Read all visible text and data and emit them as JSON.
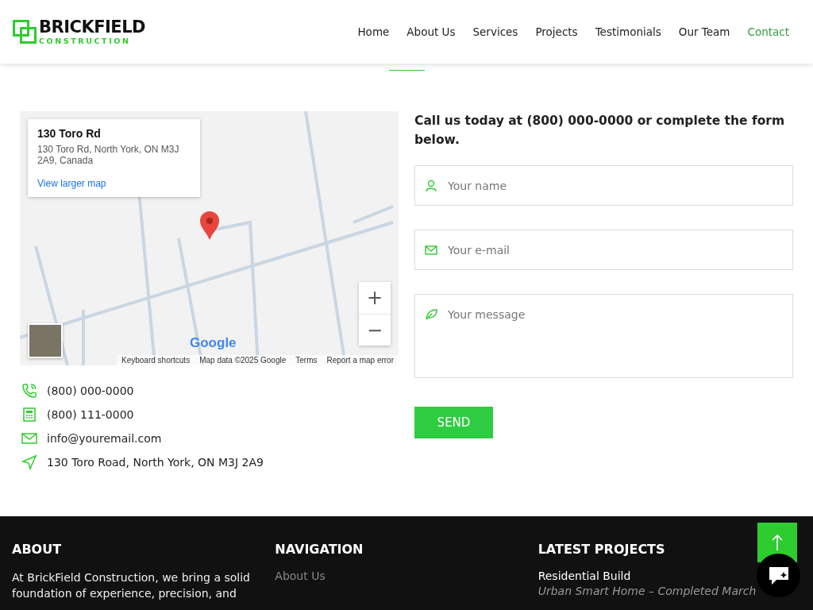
{
  "header": {
    "logo": {
      "name": "BRICKFIELD",
      "tagline": "CONSTRUCTION"
    },
    "nav": [
      {
        "label": "Home",
        "selected": false
      },
      {
        "label": "About Us",
        "selected": false
      },
      {
        "label": "Services",
        "selected": false
      },
      {
        "label": "Projects",
        "selected": false
      },
      {
        "label": "Testimonials",
        "selected": false
      },
      {
        "label": "Our Team",
        "selected": false
      },
      {
        "label": "Contact",
        "selected": true
      }
    ]
  },
  "map": {
    "info_title": "130 Toro Rd",
    "info_address": "130 Toro Rd, North York, ON M3J 2A9, Canada",
    "info_link": "View larger map",
    "zoom_in": "+",
    "zoom_out": "−",
    "logo": "Google",
    "attribution": [
      "Keyboard shortcuts",
      "Map data ©2025 Google",
      "Terms",
      "Report a map error"
    ]
  },
  "contacts": [
    {
      "kind": "phone",
      "text": "(800) 000-0000"
    },
    {
      "kind": "fax",
      "text": "(800) 111-0000"
    },
    {
      "kind": "email",
      "text": "info@youremail.com"
    },
    {
      "kind": "address",
      "text": "130 Toro Road, North York, ON M3J 2A9"
    }
  ],
  "form": {
    "intro": "Call us today at (800) 000-0000 or complete the form below.",
    "fields": [
      {
        "kind": "name",
        "placeholder": "Your name"
      },
      {
        "kind": "email",
        "placeholder": "Your e-mail"
      },
      {
        "kind": "message",
        "placeholder": "Your message"
      }
    ],
    "submit": "SEND"
  },
  "footer": {
    "about": {
      "heading": "ABOUT",
      "text": "At BrickField Construction, we bring a solid foundation of experience, precision, and"
    },
    "navigation": {
      "heading": "NAVIGATION",
      "links": [
        "About Us"
      ]
    },
    "projects": {
      "heading": "LATEST PROJECTS",
      "items": [
        {
          "title": "Residential Build",
          "subtitle": "Urban Smart Home – Completed March"
        }
      ]
    }
  }
}
